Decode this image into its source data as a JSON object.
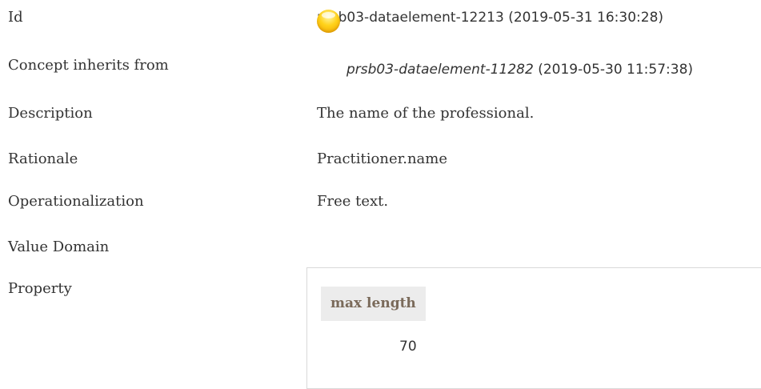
{
  "rows": {
    "id": {
      "label": "Id",
      "value": "prsb03-dataelement-12213 (2019-05-31 16:30:28)"
    },
    "inherits": {
      "label": "Concept inherits from",
      "link": "prsb03-dataelement-11282",
      "date": " (2019-05-30 11:57:38)",
      "icon": "yellow-orb-icon"
    },
    "description": {
      "label": "Description",
      "value": "The name of the professional."
    },
    "rationale": {
      "label": "Rationale",
      "value": "Practitioner.name"
    },
    "operationalization": {
      "label": "Operationalization",
      "value": "Free text."
    },
    "value_domain": {
      "label": "Value Domain"
    },
    "property": {
      "label": "Property",
      "header": "max length",
      "value": "70"
    }
  }
}
